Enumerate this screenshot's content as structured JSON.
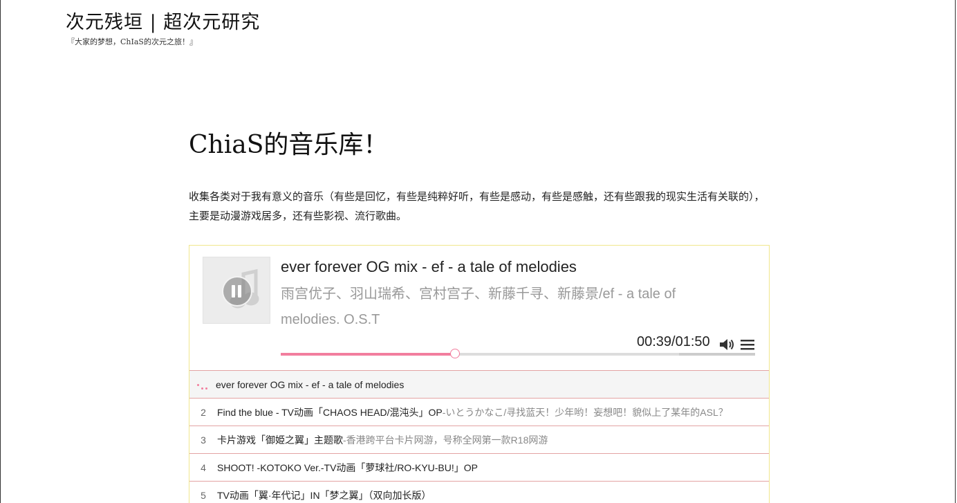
{
  "site": {
    "title": "次元残垣 | 超次元研究",
    "tagline": "『大家的梦想，ChIaS的次元之旅！』"
  },
  "page": {
    "title": "ChiaS的音乐库！",
    "intro": "收集各类对于我有意义的音乐（有些是回忆，有些是纯粹好听，有些是感动，有些是感触，还有些跟我的现实生活有关联的），主要是动漫游戏居多，还有些影视、流行歌曲。"
  },
  "player": {
    "now_playing": {
      "title": "ever forever OG mix - ef - a tale of melodies",
      "artist": "雨宫优子、羽山瑞希、宫村宫子、新藤千寻、新藤景/ef - a tale of melodies. O.S.T",
      "time": "00:39/01:50",
      "progress": 0.367,
      "loaded": 0.84
    },
    "icons": {
      "play_state": "pause-icon",
      "volume": "volume-icon",
      "menu": "list-menu-icon",
      "cover": "music-note-icon"
    },
    "accent_color": "#f27e9e",
    "playlist": [
      {
        "index": "",
        "title": "ever forever OG mix - ef - a tale of melodies",
        "separator": "",
        "author": "",
        "active": true
      },
      {
        "index": "2",
        "title": "Find the blue - TV动画「CHAOS HEAD/混沌头」OP",
        "separator": " - ",
        "author": "いとうかなこ/寻找蓝天！少年哟！妄想吧！貌似上了某年的ASL？",
        "active": false
      },
      {
        "index": "3",
        "title": "卡片游戏「御姫之翼」主题歌",
        "separator": " - ",
        "author": "香港跨平台卡片网游，号称全网第一款R18网游",
        "active": false
      },
      {
        "index": "4",
        "title": "SHOOT! -KOTOKO Ver.-TV动画「萝球社/RO-KYU-BU!」OP",
        "separator": "",
        "author": "",
        "active": false
      },
      {
        "index": "5",
        "title": "TV动画「翼·年代记」IN「梦之翼」（双向加长版）",
        "separator": "",
        "author": "",
        "active": false
      }
    ]
  }
}
